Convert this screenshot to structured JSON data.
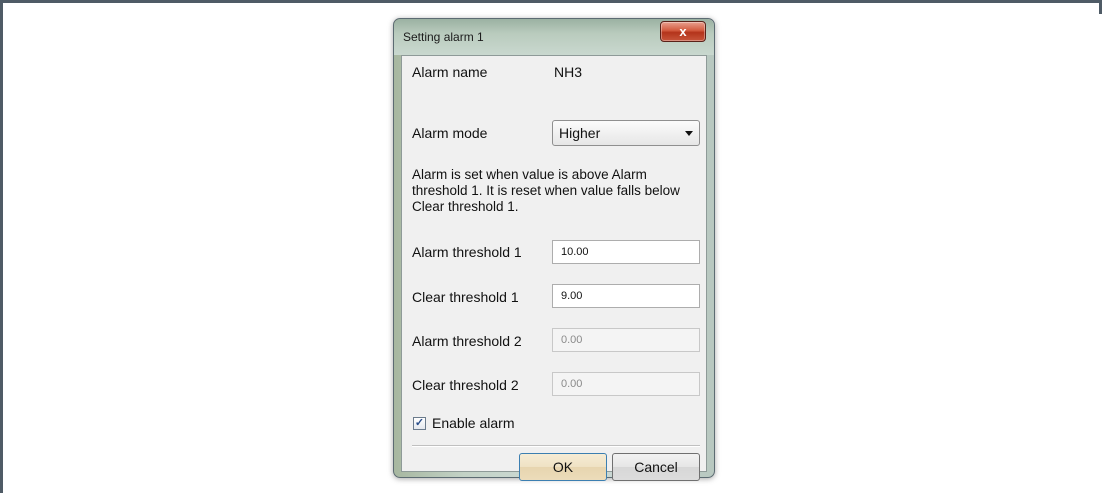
{
  "dialog": {
    "title": "Setting alarm 1",
    "close_icon": "close-icon",
    "close_glyph": "x",
    "alarm_name_label": "Alarm name",
    "alarm_name_value": "NH3",
    "alarm_mode_label": "Alarm mode",
    "alarm_mode_value": "Higher",
    "description": "Alarm is set when value is above Alarm threshold 1. It is reset when value falls below Clear threshold 1.",
    "fields": [
      {
        "label": "Alarm threshold 1",
        "value": "10.00",
        "enabled": true
      },
      {
        "label": "Clear threshold 1",
        "value": "9.00",
        "enabled": true
      },
      {
        "label": "Alarm threshold 2",
        "value": "0.00",
        "enabled": false
      },
      {
        "label": "Clear threshold 2",
        "value": "0.00",
        "enabled": false
      }
    ],
    "enable_alarm_label": "Enable alarm",
    "enable_alarm_checked": true,
    "ok_label": "OK",
    "cancel_label": "Cancel"
  }
}
